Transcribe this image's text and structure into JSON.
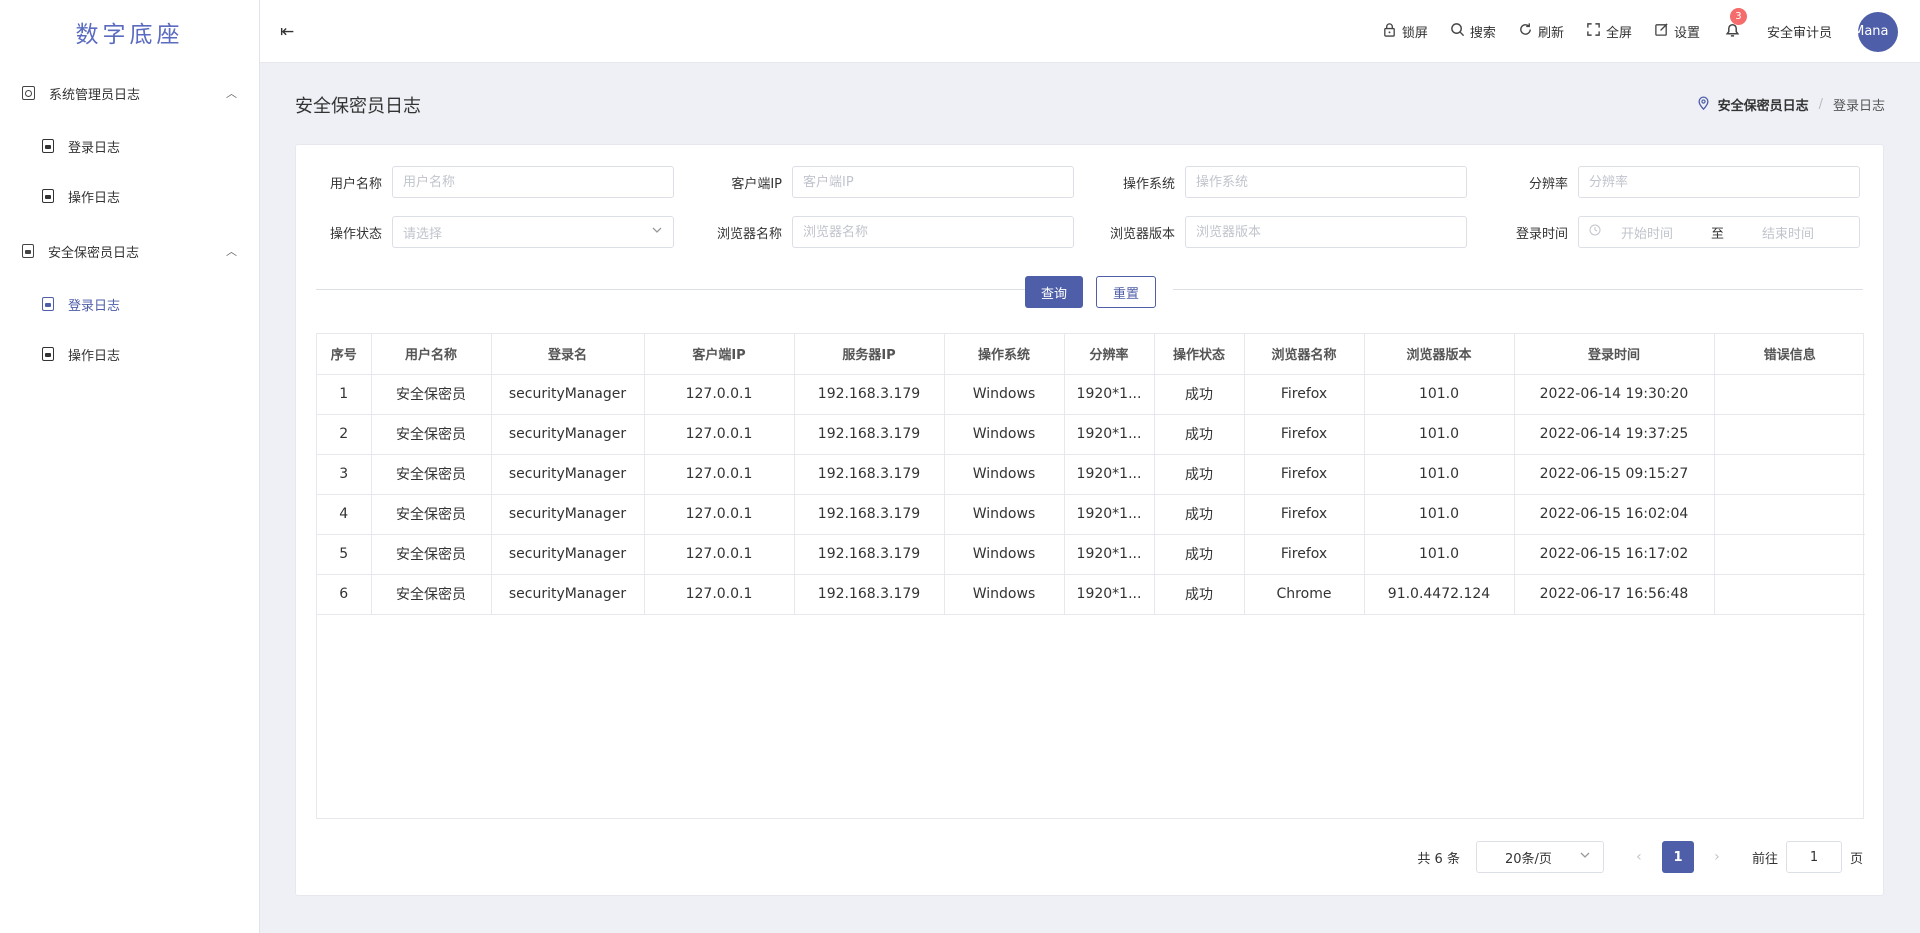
{
  "app": {
    "logo": "数字底座"
  },
  "sidebar": {
    "groups": [
      {
        "label": "系统管理员日志",
        "chevron": "^",
        "items": [
          {
            "label": "登录日志"
          },
          {
            "label": "操作日志"
          }
        ]
      },
      {
        "label": "安全保密员日志",
        "chevron": "^",
        "items": [
          {
            "label": "登录日志",
            "active": true
          },
          {
            "label": "操作日志"
          }
        ]
      }
    ]
  },
  "header": {
    "collapse_icon": "⇤",
    "tools": [
      {
        "label": "锁屏",
        "icon": "lock-icon"
      },
      {
        "label": "搜索",
        "icon": "search-icon"
      },
      {
        "label": "刷新",
        "icon": "refresh-icon"
      },
      {
        "label": "全屏",
        "icon": "fullscreen-icon"
      },
      {
        "label": "设置",
        "icon": "settings-icon"
      }
    ],
    "notification_count": "3",
    "username": "安全审计员",
    "avatar_text": "tMana"
  },
  "page": {
    "title": "安全保密员日志",
    "breadcrumb": [
      "安全保密员日志",
      "登录日志"
    ],
    "breadcrumb_sep": "/"
  },
  "filters": {
    "username": {
      "label": "用户名称",
      "placeholder": "用户名称"
    },
    "client_ip": {
      "label": "客户端IP",
      "placeholder": "客户端IP"
    },
    "os": {
      "label": "操作系统",
      "placeholder": "操作系统"
    },
    "resolution": {
      "label": "分辨率",
      "placeholder": "分辨率"
    },
    "status": {
      "label": "操作状态",
      "placeholder": "请选择"
    },
    "browser_name": {
      "label": "浏览器名称",
      "placeholder": "浏览器名称"
    },
    "browser_version": {
      "label": "浏览器版本",
      "placeholder": "浏览器版本"
    },
    "login_time": {
      "label": "登录时间",
      "start_placeholder": "开始时间",
      "range_sep": "至",
      "end_placeholder": "结束时间"
    },
    "query_label": "查询",
    "reset_label": "重置"
  },
  "table": {
    "columns": [
      "序号",
      "用户名称",
      "登录名",
      "客户端IP",
      "服务器IP",
      "操作系统",
      "分辨率",
      "操作状态",
      "浏览器名称",
      "浏览器版本",
      "登录时间",
      "错误信息"
    ],
    "rows": [
      [
        "1",
        "安全保密员",
        "securityManager",
        "127.0.0.1",
        "192.168.3.179",
        "Windows",
        "1920*1...",
        "成功",
        "Firefox",
        "101.0",
        "2022-06-14 19:30:20",
        ""
      ],
      [
        "2",
        "安全保密员",
        "securityManager",
        "127.0.0.1",
        "192.168.3.179",
        "Windows",
        "1920*1...",
        "成功",
        "Firefox",
        "101.0",
        "2022-06-14 19:37:25",
        ""
      ],
      [
        "3",
        "安全保密员",
        "securityManager",
        "127.0.0.1",
        "192.168.3.179",
        "Windows",
        "1920*1...",
        "成功",
        "Firefox",
        "101.0",
        "2022-06-15 09:15:27",
        ""
      ],
      [
        "4",
        "安全保密员",
        "securityManager",
        "127.0.0.1",
        "192.168.3.179",
        "Windows",
        "1920*1...",
        "成功",
        "Firefox",
        "101.0",
        "2022-06-15 16:02:04",
        ""
      ],
      [
        "5",
        "安全保密员",
        "securityManager",
        "127.0.0.1",
        "192.168.3.179",
        "Windows",
        "1920*1...",
        "成功",
        "Firefox",
        "101.0",
        "2022-06-15 16:17:02",
        ""
      ],
      [
        "6",
        "安全保密员",
        "securityManager",
        "127.0.0.1",
        "192.168.3.179",
        "Windows",
        "1920*1...",
        "成功",
        "Chrome",
        "91.0.4472.124",
        "2022-06-17 16:56:48",
        ""
      ]
    ]
  },
  "pagination": {
    "total": "共 6 条",
    "page_size": "20条/页",
    "current_page": "1",
    "goto_label": "前往",
    "goto_value": "1",
    "page_suffix": "页"
  },
  "colors": {
    "accent": "#4e5ea8",
    "badge": "#f56c6c",
    "background": "#eef0f5"
  }
}
